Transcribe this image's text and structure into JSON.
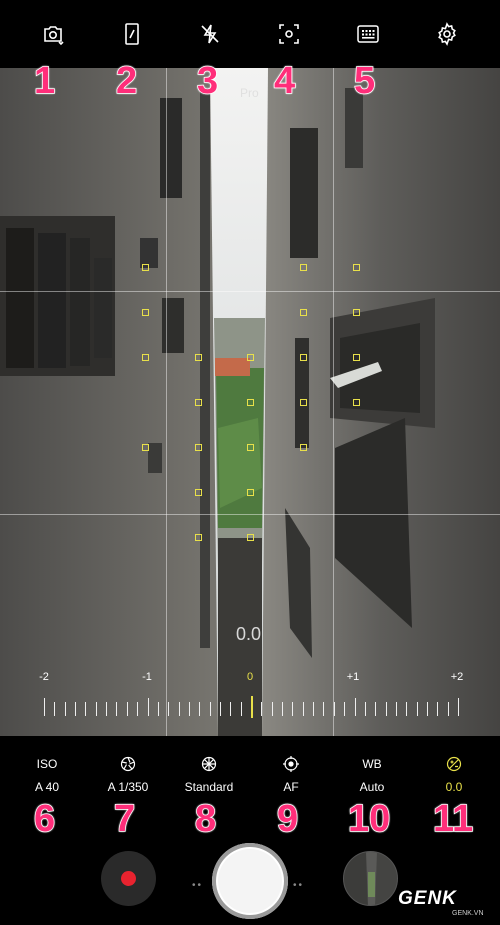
{
  "top_bar": {
    "icons": [
      "switch-camera-icon",
      "aspect-ratio-icon",
      "flash-off-icon",
      "metering-mode-icon",
      "timer-grid-icon",
      "settings-gear-icon"
    ]
  },
  "annotations": [
    "1",
    "2",
    "3",
    "4",
    "5",
    "6",
    "7",
    "8",
    "9",
    "10",
    "11"
  ],
  "viewfinder": {
    "mode_label": "Pro",
    "ev_readout": "0.0",
    "ruler_labels": [
      "-2",
      "-1",
      "0",
      "+1",
      "+2"
    ],
    "ruler_active": "0"
  },
  "pro_controls": [
    {
      "name": "iso",
      "label": "ISO",
      "value": "A 40"
    },
    {
      "name": "shutter-speed",
      "icon": "aperture-icon",
      "value": "A 1/350"
    },
    {
      "name": "color-tone",
      "icon": "color-tone-icon",
      "value": "Standard"
    },
    {
      "name": "focus",
      "icon": "focus-icon",
      "value": "AF"
    },
    {
      "name": "white-balance",
      "label": "WB",
      "value": "Auto"
    },
    {
      "name": "exposure",
      "icon": "exposure-icon",
      "value": "0.0"
    }
  ],
  "bottom": {
    "record_button": "record-icon",
    "shutter_button": "shutter-icon",
    "gallery_button": "gallery-thumbnail"
  },
  "watermark": {
    "brand": "GENK",
    "domain": "GENK.VN"
  },
  "colors": {
    "accent_yellow": "#e8e04a",
    "annotation_pink": "#ff2e7a",
    "record_red": "#e8232f"
  }
}
